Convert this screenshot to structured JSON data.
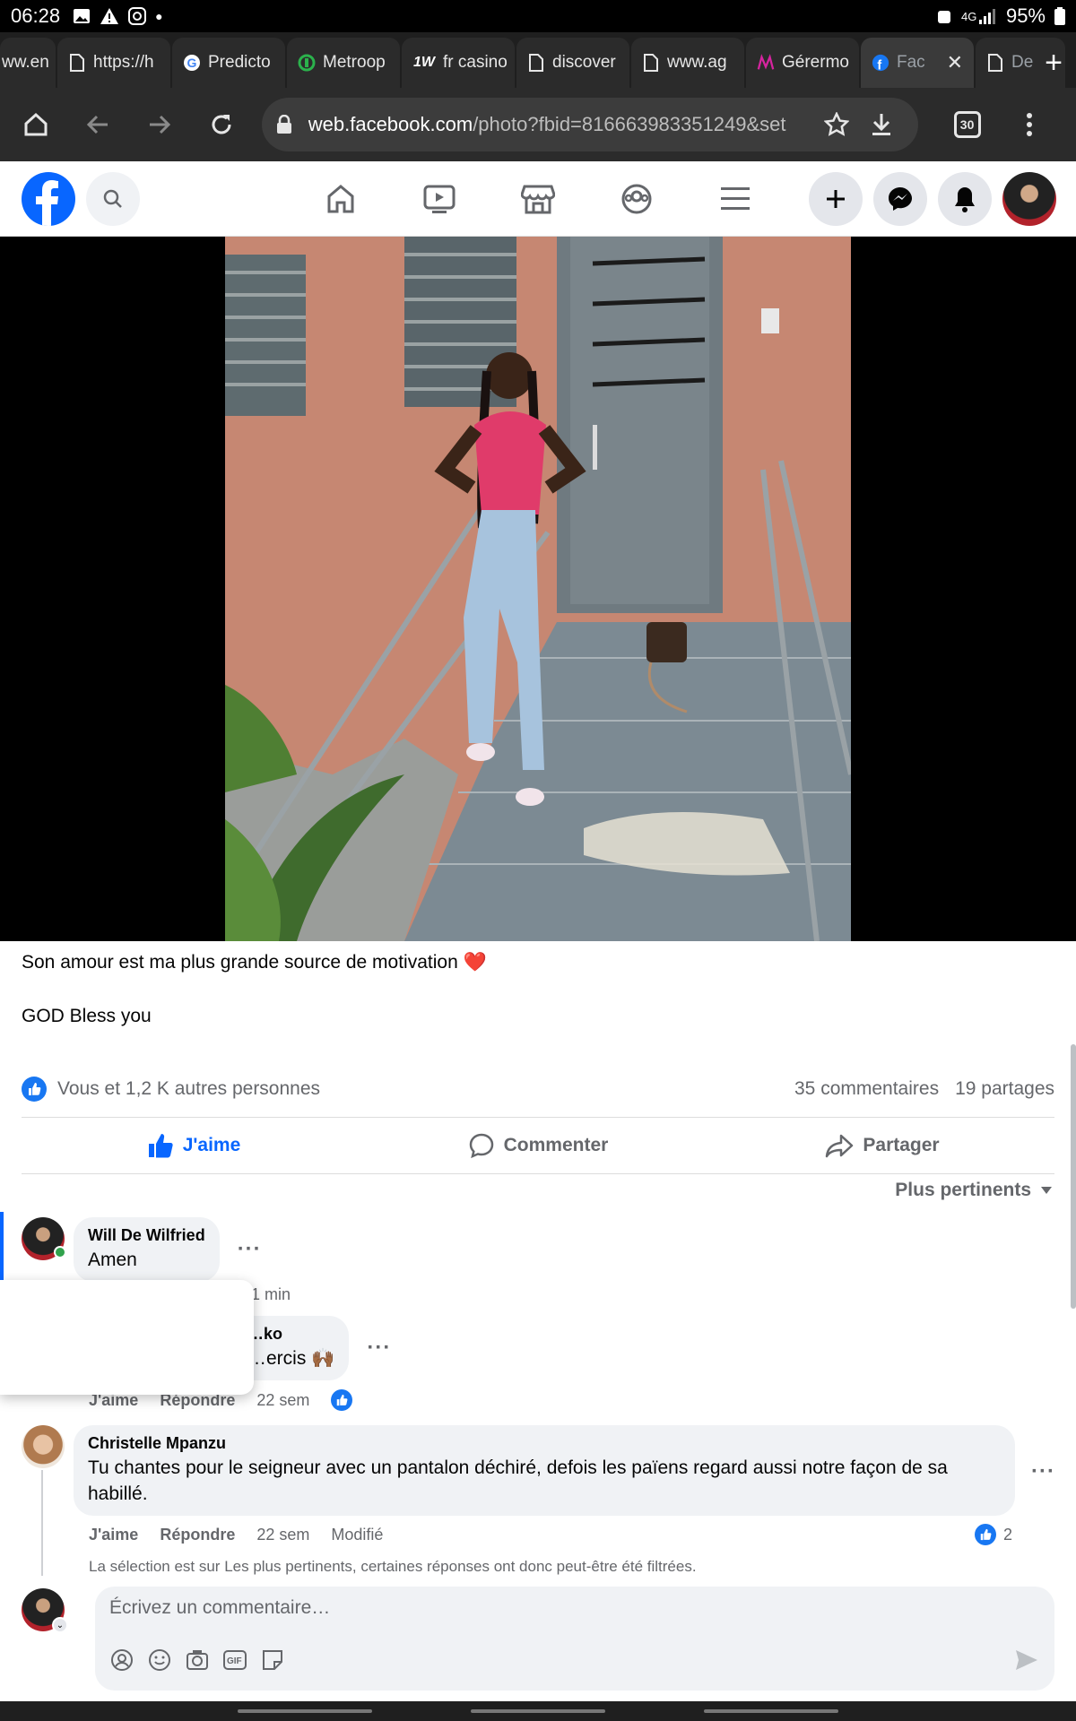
{
  "status_bar": {
    "time": "06:28",
    "battery": "95%"
  },
  "tabs": [
    {
      "label": "ww.en",
      "icon": "page-icon"
    },
    {
      "label": "https://h",
      "icon": "page-icon"
    },
    {
      "label": "Predicto",
      "icon": "google-icon"
    },
    {
      "label": "Metroop",
      "icon": "metro-icon"
    },
    {
      "label": "fr casino",
      "icon": "1w-icon"
    },
    {
      "label": "discover",
      "icon": "page-icon"
    },
    {
      "label": "www.ag",
      "icon": "page-icon"
    },
    {
      "label": "Gérermo",
      "icon": "meta-icon"
    },
    {
      "label": "Fac",
      "icon": "facebook-icon",
      "active": true
    },
    {
      "label": "De",
      "icon": "page-icon"
    }
  ],
  "toolbar": {
    "url_host": "web.facebook.com",
    "url_path": "/photo?fbid=816663983351249&set",
    "tab_count": "30"
  },
  "post": {
    "caption": "Son amour est ma plus grande source de motivation ❤️",
    "caption2": "GOD Bless you",
    "reactions_text": "Vous et 1,2 K autres personnes",
    "comments_count": "35 commentaires",
    "shares_count": "19 partages"
  },
  "actions": {
    "like": "J'aime",
    "comment": "Commenter",
    "share": "Partager"
  },
  "sort_label": "Plus pertinents",
  "comments": [
    {
      "name": "Will De Wilfried",
      "text": "Amen",
      "time": "1 min"
    },
    {
      "name": "…ko",
      "text": "…ercis 🙌🏾",
      "like": "J'aime",
      "reply": "Répondre",
      "time": "22 sem"
    },
    {
      "name": "Christelle Mpanzu",
      "text": "Tu chantes pour le seigneur avec un pantalon déchiré, defois les païens regard aussi notre façon de sa habillé.",
      "like": "J'aime",
      "reply": "Répondre",
      "time": "22 sem",
      "edited": "Modifié",
      "reaction_count": "2"
    }
  ],
  "filter_note": "La sélection est sur Les plus pertinents, certaines réponses ont donc peut-être été filtrées.",
  "composer": {
    "placeholder": "Écrivez un commentaire…"
  },
  "colors": {
    "fb_blue": "#0866ff",
    "like_blue": "#1877f2"
  }
}
